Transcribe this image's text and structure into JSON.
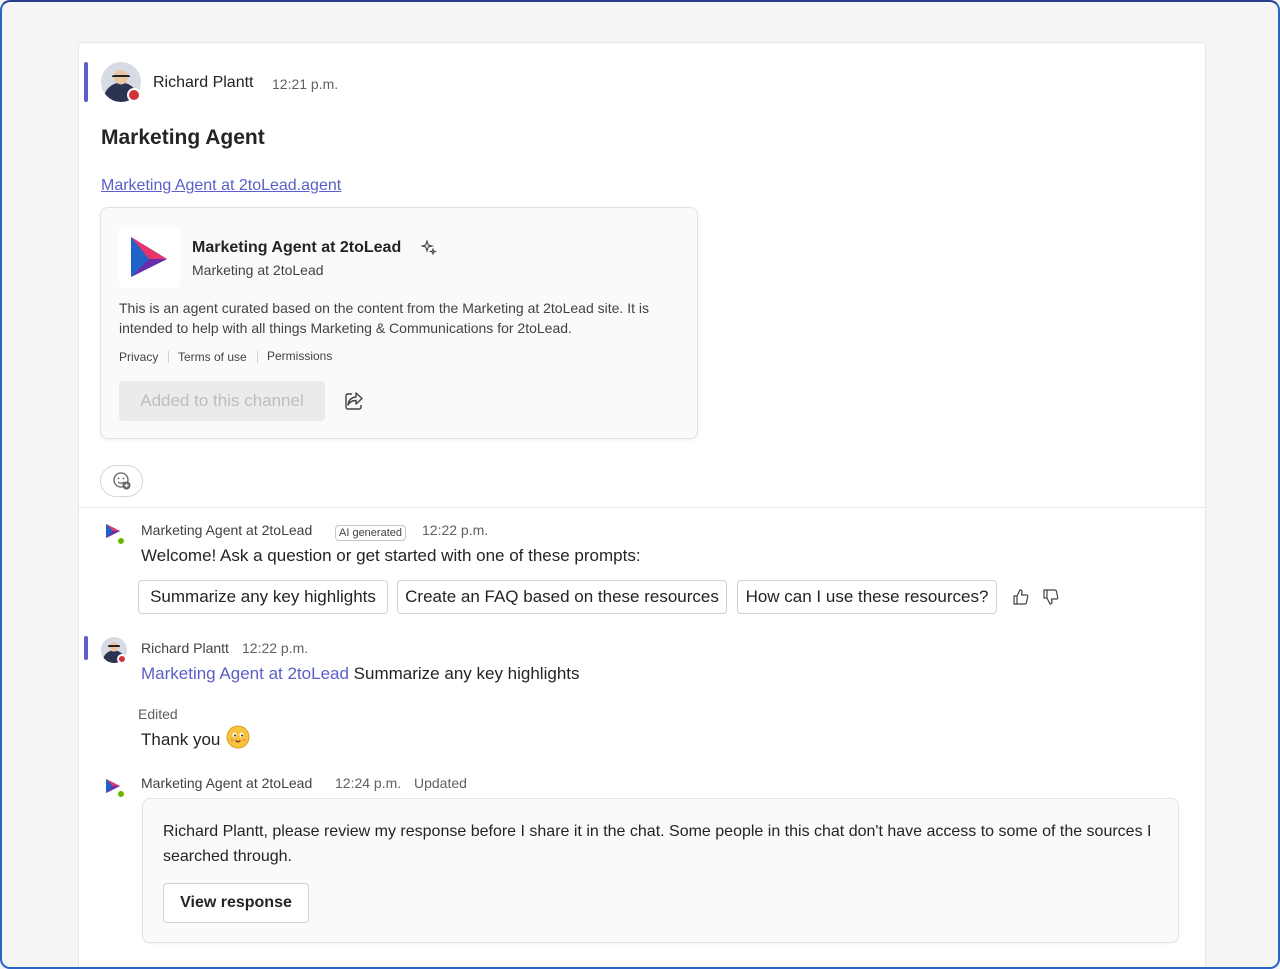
{
  "post": {
    "author": "Richard Plantt",
    "time": "12:21 p.m.",
    "title": "Marketing Agent",
    "link_text": "Marketing Agent at 2toLead.agent"
  },
  "agent_card": {
    "title": "Marketing Agent at 2toLead",
    "subtitle": "Marketing at 2toLead",
    "description": "This is an agent curated based on the content from the Marketing at 2toLead site. It is intended to help with all things Marketing & Communications for 2toLead.",
    "links": [
      "Privacy",
      "Terms of use",
      "Permissions"
    ],
    "added_button": "Added to this channel"
  },
  "agent_reply": {
    "author": "Marketing Agent at 2toLead",
    "badge": "AI generated",
    "time": "12:22 p.m.",
    "text": "Welcome! Ask a question or get started with one of these prompts:",
    "prompts": [
      "Summarize any key highlights",
      "Create an FAQ based on these resources",
      "How can I use these resources?"
    ]
  },
  "user_reply": {
    "author": "Richard Plantt",
    "time": "12:22 p.m.",
    "mention": "Marketing Agent at 2toLead",
    "text": "Summarize any key highlights",
    "edited_label": "Edited",
    "thanks": "Thank you"
  },
  "agent_update": {
    "author": "Marketing Agent at 2toLead",
    "time": "12:24 p.m.",
    "status": "Updated",
    "review_text": "Richard Plantt, please review my response before I share it in the chat. Some people in this chat don't have access to some of the sources I searched through.",
    "view_button": "View response"
  },
  "colors": {
    "accent": "#5b5fc7",
    "presence_busy": "#d13438",
    "presence_available": "#6bb700",
    "frame": "#2b63c9"
  },
  "icons": [
    "sparkle-icon",
    "share-icon",
    "add-reaction-icon",
    "thumbs-up-icon",
    "thumbs-down-icon",
    "smile-emoji"
  ]
}
